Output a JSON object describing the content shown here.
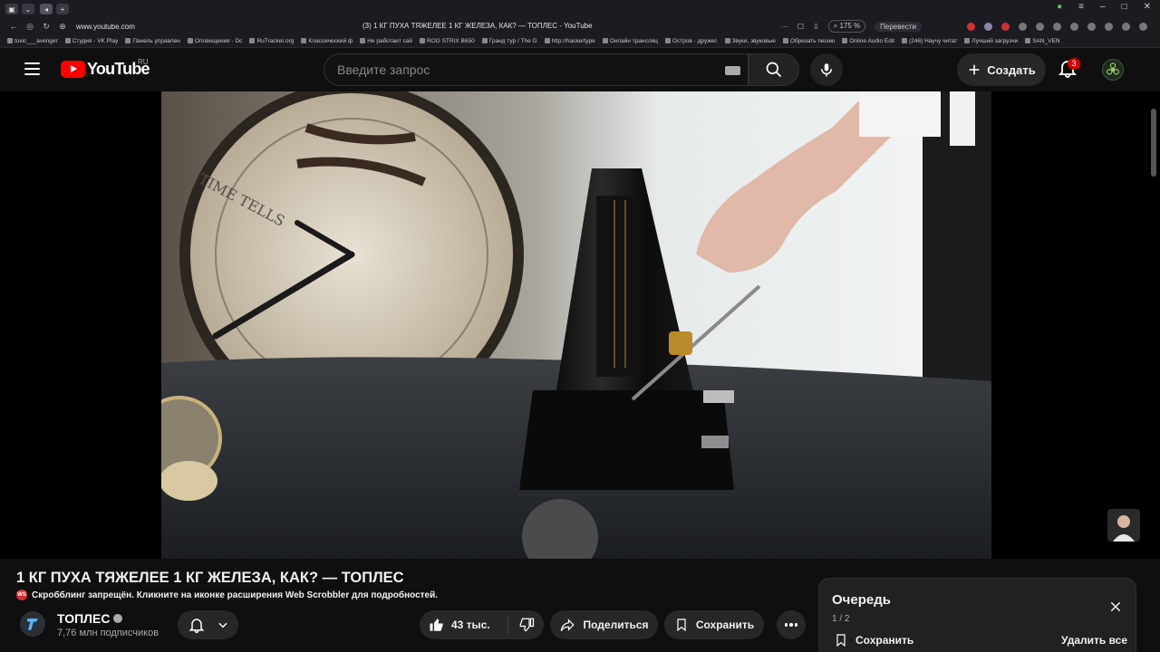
{
  "browser": {
    "url": "www.youtube.com",
    "tab_title": "(3) 1 КГ ПУХА ТЯЖЕЛЕЕ 1 КГ ЖЕЛЕЗА, КАК? — ТОПЛЕС - YouTube",
    "zoom": "175 %",
    "translate_label": "Перевести",
    "bookmarks": [
      "toxic___avenger",
      "Студия - VK Play",
      "Панель управлен",
      "Оповещения - Dc",
      "RuTracker.org",
      "Классический ф",
      "Не работает сай",
      "ROG STRIX B650",
      "Гранд тур / The G",
      "http://hackertype",
      "Онлайн трансляц",
      "Остров - дружес",
      "Звуки, звуковые",
      "Обрезать песню",
      "Online Audio Edit",
      "(246) Научу читат",
      "Лучший загрузчи",
      "SAN_VEN"
    ]
  },
  "header": {
    "logo_text": "YouTube",
    "region": "RU",
    "search_placeholder": "Введите запрос",
    "create_label": "Создать",
    "notification_count": "3"
  },
  "video": {
    "title": "1 КГ ПУХА ТЯЖЕЛЕЕ 1 КГ ЖЕЛЕЗА, КАК? — ТОПЛЕС",
    "scrobble_notice": "Скробблинг запрещён. Кликните на иконке расширения Web Scrobbler для подробностей.",
    "scrobble_icon_text": "WS",
    "channel_name": "ТОПЛЕС",
    "subscribers": "7,76 млн подписчиков",
    "likes": "43 тыс.",
    "share_label": "Поделиться",
    "save_label": "Сохранить"
  },
  "queue": {
    "title": "Очередь",
    "count": "1 / 2",
    "save_label": "Сохранить",
    "delete_all_label": "Удалить все"
  },
  "colors": {
    "background": "#0f0f0f",
    "accent_red": "#ff0000",
    "button_bg": "#272727"
  }
}
